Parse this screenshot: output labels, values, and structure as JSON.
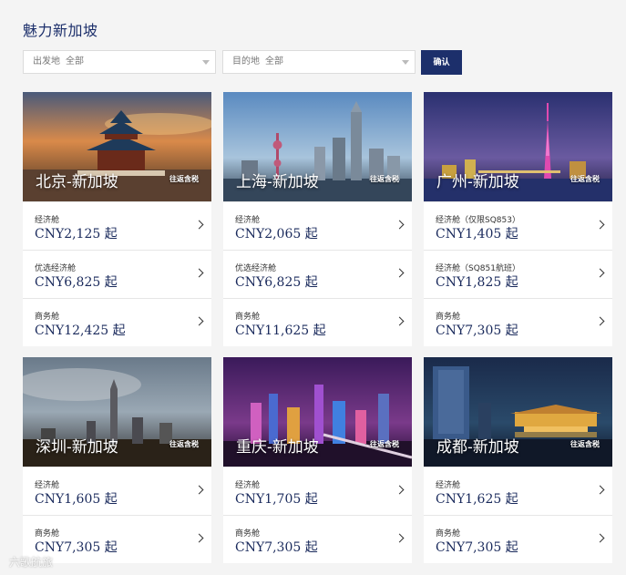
{
  "page": {
    "title": "魅力新加坡"
  },
  "filters": {
    "origin": {
      "label": "出发地",
      "value": "全部"
    },
    "destination": {
      "label": "目的地",
      "value": "全部"
    },
    "confirm_label": "确认"
  },
  "routes": [
    {
      "city": "北京-新加坡",
      "tax": "往返含税",
      "fares": [
        {
          "class": "经济舱",
          "price": "CNY2,125 起"
        },
        {
          "class": "优选经济舱",
          "price": "CNY6,825 起"
        },
        {
          "class": "商务舱",
          "price": "CNY12,425 起"
        }
      ]
    },
    {
      "city": "上海-新加坡",
      "tax": "往返含税",
      "fares": [
        {
          "class": "经济舱",
          "price": "CNY2,065 起"
        },
        {
          "class": "优选经济舱",
          "price": "CNY6,825 起"
        },
        {
          "class": "商务舱",
          "price": "CNY11,625 起"
        }
      ]
    },
    {
      "city": "广州-新加坡",
      "tax": "往返含税",
      "fares": [
        {
          "class": "经济舱（仅限SQ853）",
          "price": "CNY1,405 起"
        },
        {
          "class": "经济舱（SQ851航班）",
          "price": "CNY1,825 起"
        },
        {
          "class": "商务舱",
          "price": "CNY7,305 起"
        }
      ]
    },
    {
      "city": "深圳-新加坡",
      "tax": "往返含税",
      "fares": [
        {
          "class": "经济舱",
          "price": "CNY1,605 起"
        },
        {
          "class": "商务舱",
          "price": "CNY7,305 起"
        }
      ]
    },
    {
      "city": "重庆-新加坡",
      "tax": "往返含税",
      "fares": [
        {
          "class": "经济舱",
          "price": "CNY1,705 起"
        },
        {
          "class": "商务舱",
          "price": "CNY7,305 起"
        }
      ]
    },
    {
      "city": "成都-新加坡",
      "tax": "往返含税",
      "fares": [
        {
          "class": "经济舱",
          "price": "CNY1,625 起"
        },
        {
          "class": "商务舱",
          "price": "CNY7,305 起"
        }
      ]
    }
  ],
  "watermark": "六歌航旅",
  "colors": {
    "brand": "#1c2f6b",
    "background": "#f4f4f4"
  }
}
